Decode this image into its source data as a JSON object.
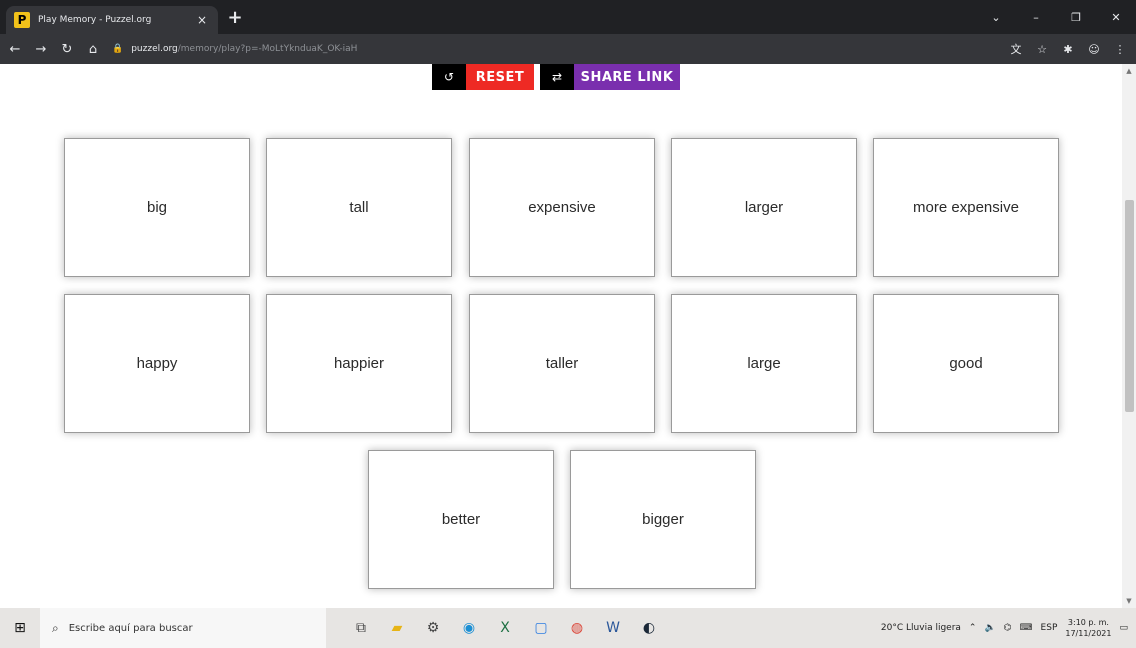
{
  "browser": {
    "tab_title": "Play Memory - Puzzel.org",
    "tab_close": "×",
    "new_tab": "+",
    "favicon_letter": "P",
    "url_host": "puzzel.org",
    "url_path": "/memory/play?p=-MoLtYknduaK_OK-iaH",
    "window_controls": {
      "minimize": "–",
      "maximize": "❐",
      "close": "✕",
      "dropdown": "⌄"
    },
    "nav": {
      "back": "←",
      "forward": "→",
      "reload": "↻",
      "home": "⌂",
      "lock": "🔒"
    },
    "toolbar_icons": {
      "translate": "文",
      "bookmark": "☆",
      "extensions": "✱",
      "profile": "☺",
      "menu": "⋮"
    }
  },
  "controls": {
    "reset_label": "RESET",
    "share_label": "SHARE LINK",
    "reset_icon": "↺",
    "share_icon": "⇄"
  },
  "cards": [
    {
      "text": "big"
    },
    {
      "text": "tall"
    },
    {
      "text": "expensive"
    },
    {
      "text": "larger"
    },
    {
      "text": "more expensive"
    },
    {
      "text": "happy"
    },
    {
      "text": "happier"
    },
    {
      "text": "taller"
    },
    {
      "text": "large"
    },
    {
      "text": "good"
    },
    {
      "text": "better"
    },
    {
      "text": "bigger"
    }
  ],
  "taskbar": {
    "search_placeholder": "Escribe aquí para buscar",
    "weather": "20°C  Lluvia ligera",
    "language": "ESP",
    "time": "3:10 p. m.",
    "date": "17/11/2021",
    "apps": [
      {
        "icon": "task-view-icon",
        "glyph": "⧉",
        "color": "#444444"
      },
      {
        "icon": "file-explorer-icon",
        "glyph": "▰",
        "color": "#e7b416"
      },
      {
        "icon": "settings-icon",
        "glyph": "⚙",
        "color": "#444444"
      },
      {
        "icon": "edge-icon",
        "glyph": "◉",
        "color": "#1b8fd4"
      },
      {
        "icon": "excel-icon",
        "glyph": "X",
        "color": "#1d6f42"
      },
      {
        "icon": "app-blue-icon",
        "glyph": "▢",
        "color": "#2f7de1"
      },
      {
        "icon": "chrome-icon",
        "glyph": "◍",
        "color": "#db4437"
      },
      {
        "icon": "word-icon",
        "glyph": "W",
        "color": "#2b579a"
      },
      {
        "icon": "steam-icon",
        "glyph": "◐",
        "color": "#1b2838"
      }
    ]
  }
}
